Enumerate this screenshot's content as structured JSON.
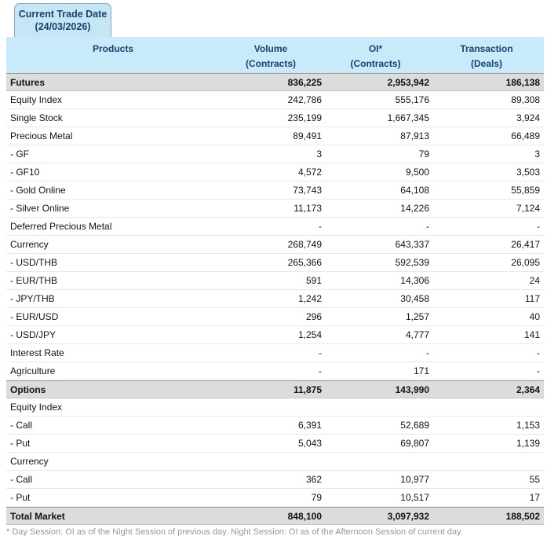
{
  "tab": {
    "line1": "Current Trade Date",
    "line2": "(24/03/2026)"
  },
  "table": {
    "headers": [
      {
        "line1": "Products",
        "line2": ""
      },
      {
        "line1": "Volume",
        "line2": "(Contracts)"
      },
      {
        "line1": "OI*",
        "line2": "(Contracts)"
      },
      {
        "line1": "Transaction",
        "line2": "(Deals)"
      }
    ],
    "rows": [
      {
        "product": "Futures",
        "volume": "836,225",
        "oi": "2,953,942",
        "transaction": "186,138",
        "type": "section"
      },
      {
        "product": "Equity Index",
        "volume": "242,786",
        "oi": "555,176",
        "transaction": "89,308",
        "type": "normal"
      },
      {
        "product": "Single Stock",
        "volume": "235,199",
        "oi": "1,667,345",
        "transaction": "3,924",
        "type": "normal"
      },
      {
        "product": "Precious Metal",
        "volume": "89,491",
        "oi": "87,913",
        "transaction": "66,489",
        "type": "normal"
      },
      {
        "product": "- GF",
        "volume": "3",
        "oi": "79",
        "transaction": "3",
        "type": "normal"
      },
      {
        "product": "- GF10",
        "volume": "4,572",
        "oi": "9,500",
        "transaction": "3,503",
        "type": "normal"
      },
      {
        "product": "- Gold Online",
        "volume": "73,743",
        "oi": "64,108",
        "transaction": "55,859",
        "type": "normal"
      },
      {
        "product": "- Silver Online",
        "volume": "11,173",
        "oi": "14,226",
        "transaction": "7,124",
        "type": "normal"
      },
      {
        "product": "Deferred Precious Metal",
        "volume": "-",
        "oi": "-",
        "transaction": "-",
        "type": "normal"
      },
      {
        "product": "Currency",
        "volume": "268,749",
        "oi": "643,337",
        "transaction": "26,417",
        "type": "normal"
      },
      {
        "product": "- USD/THB",
        "volume": "265,366",
        "oi": "592,539",
        "transaction": "26,095",
        "type": "normal"
      },
      {
        "product": "- EUR/THB",
        "volume": "591",
        "oi": "14,306",
        "transaction": "24",
        "type": "normal"
      },
      {
        "product": "- JPY/THB",
        "volume": "1,242",
        "oi": "30,458",
        "transaction": "117",
        "type": "normal"
      },
      {
        "product": "- EUR/USD",
        "volume": "296",
        "oi": "1,257",
        "transaction": "40",
        "type": "normal"
      },
      {
        "product": "- USD/JPY",
        "volume": "1,254",
        "oi": "4,777",
        "transaction": "141",
        "type": "normal"
      },
      {
        "product": "Interest Rate",
        "volume": "-",
        "oi": "-",
        "transaction": "-",
        "type": "normal"
      },
      {
        "product": "Agriculture",
        "volume": "-",
        "oi": "171",
        "transaction": "-",
        "type": "normal"
      },
      {
        "product": "Options",
        "volume": "11,875",
        "oi": "143,990",
        "transaction": "2,364",
        "type": "section"
      },
      {
        "product": "Equity Index",
        "volume": "",
        "oi": "",
        "transaction": "",
        "type": "normal"
      },
      {
        "product": "- Call",
        "volume": "6,391",
        "oi": "52,689",
        "transaction": "1,153",
        "type": "normal"
      },
      {
        "product": "- Put",
        "volume": "5,043",
        "oi": "69,807",
        "transaction": "1,139",
        "type": "normal"
      },
      {
        "product": "Currency",
        "volume": "",
        "oi": "",
        "transaction": "",
        "type": "normal"
      },
      {
        "product": "- Call",
        "volume": "362",
        "oi": "10,977",
        "transaction": "55",
        "type": "normal"
      },
      {
        "product": "- Put",
        "volume": "79",
        "oi": "10,517",
        "transaction": "17",
        "type": "normal"
      },
      {
        "product": "Total Market",
        "volume": "848,100",
        "oi": "3,097,932",
        "transaction": "188,502",
        "type": "section"
      }
    ]
  },
  "footnote": "* Day Session: OI as of the Night Session of previous day. Night Session: OI as of the Afternoon Session of current day.",
  "colors": {
    "tab_bg": "#c6e6f6",
    "tab_border": "#90a4b4",
    "header_bg": "#c9eafa",
    "navy_text": "#17436b",
    "section_bg": "#dcdcdc",
    "section_border": "#a0a0a0",
    "row_border": "#e9e9e9",
    "text": "#121212",
    "footnote": "#979797"
  }
}
